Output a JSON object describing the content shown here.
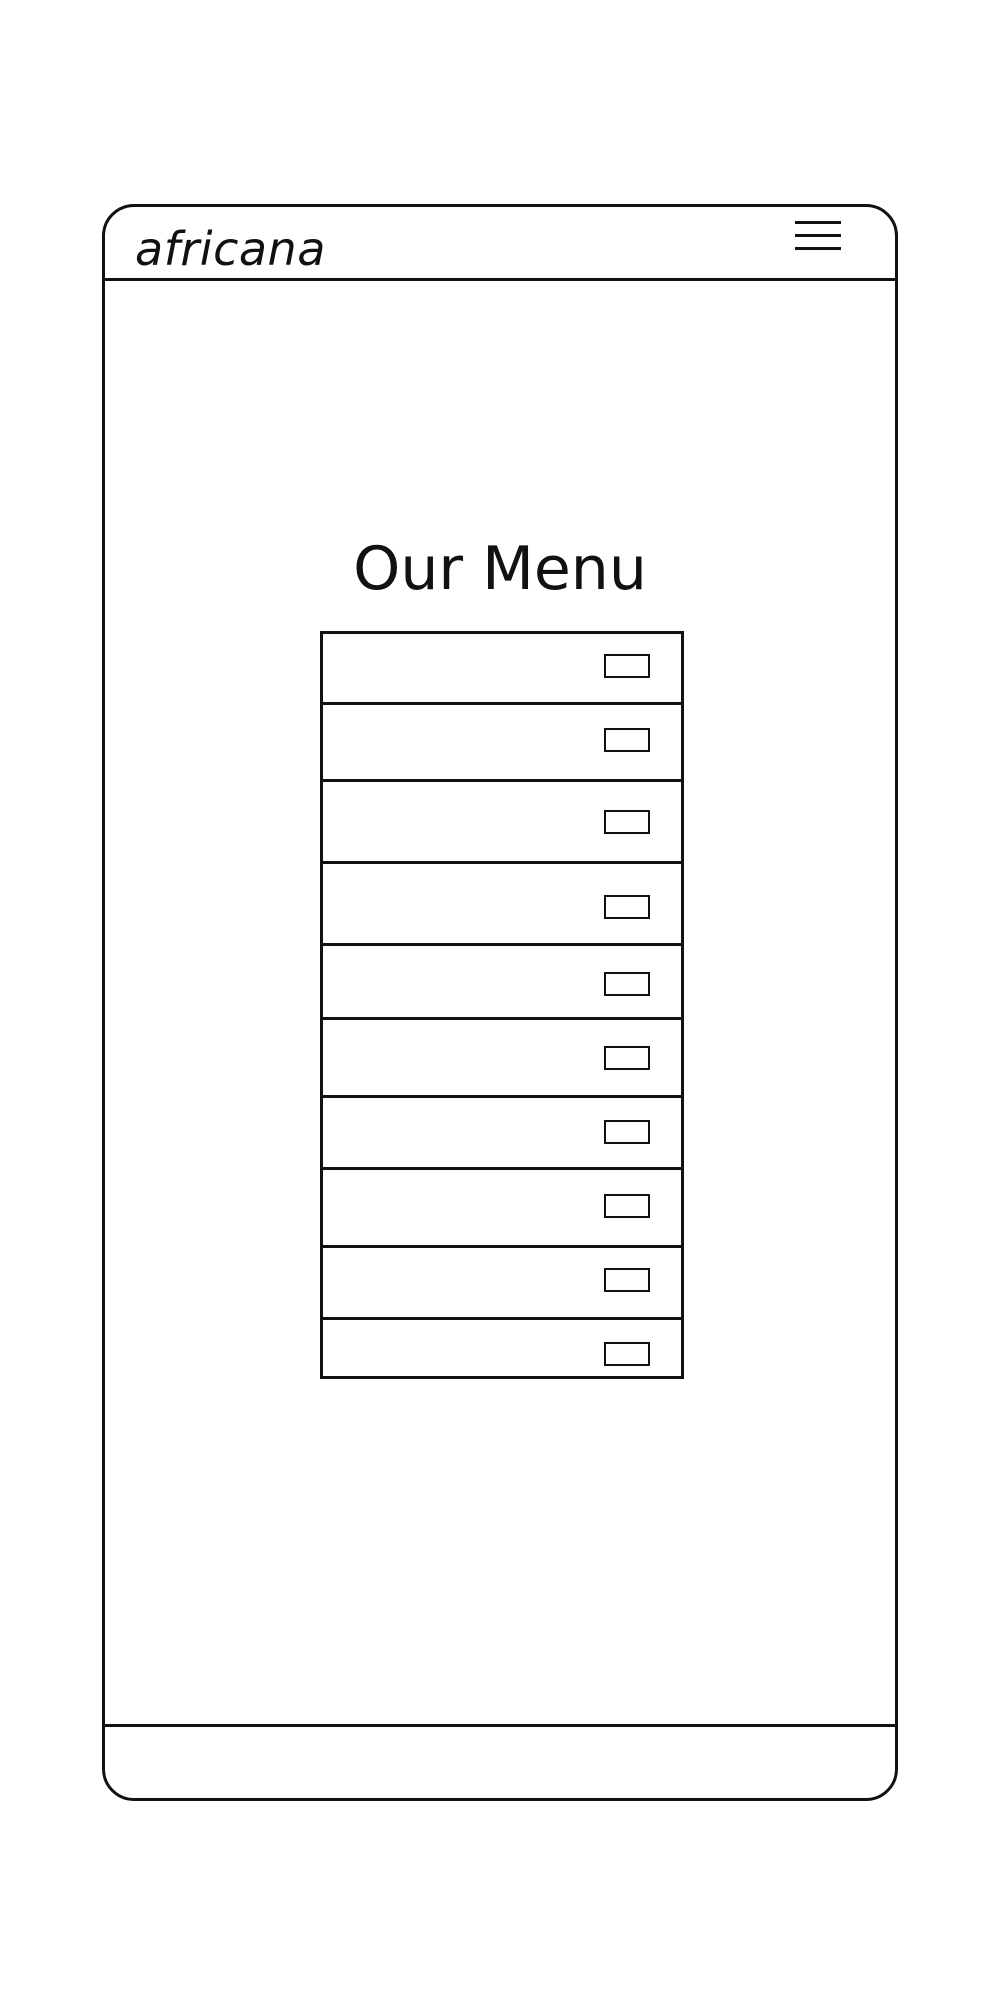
{
  "app": {
    "brand": "africana",
    "menu_icon": "hamburger-menu-icon"
  },
  "main": {
    "title": "Our Menu",
    "items": [
      {
        "label": ""
      },
      {
        "label": ""
      },
      {
        "label": ""
      },
      {
        "label": ""
      },
      {
        "label": ""
      },
      {
        "label": ""
      },
      {
        "label": ""
      },
      {
        "label": ""
      },
      {
        "label": ""
      },
      {
        "label": ""
      }
    ]
  },
  "footer": {
    "text": ""
  }
}
